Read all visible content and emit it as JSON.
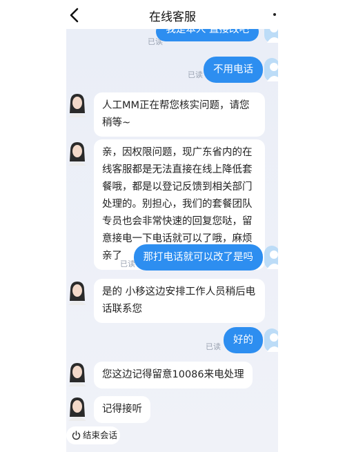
{
  "header": {
    "title": "在线客服"
  },
  "messages": [
    {
      "side": "right",
      "text": "我是本人 直接改吧",
      "read": "已读"
    },
    {
      "side": "right",
      "text": "不用电话",
      "read": "已读"
    },
    {
      "side": "left",
      "text": "人工MM正在帮您核实问题，请您稍等~"
    },
    {
      "side": "left",
      "text": "亲，因权限问题，现广东省内的在线客服都是无法直接在线上降低套餐哦，都是以登记反馈到相关部门处理的。别担心，我们的套餐团队专员也会非常快速的回复您哒，留意接电一下电话就可以了哦，麻烦亲了"
    },
    {
      "side": "right",
      "text": "那打电话就可以改了是吗",
      "read": "已读"
    },
    {
      "side": "left",
      "text": "是的 小移这边安排工作人员稍后电话联系您"
    },
    {
      "side": "right",
      "text": "好的",
      "read": "已读"
    },
    {
      "side": "left",
      "text": "您这边记得留意10086来电处理"
    },
    {
      "side": "left",
      "text": "记得接听"
    }
  ],
  "footer": {
    "end_session_label": "结束会话"
  },
  "icons": {
    "back": "chevron-left-icon",
    "more": "more-dot-icon",
    "end": "power-icon"
  },
  "colors": {
    "user_bubble": "#2d8ef0",
    "agent_bubble": "#ffffff",
    "chat_bg": "#eaeef7",
    "read_text": "#9aa3b2"
  }
}
